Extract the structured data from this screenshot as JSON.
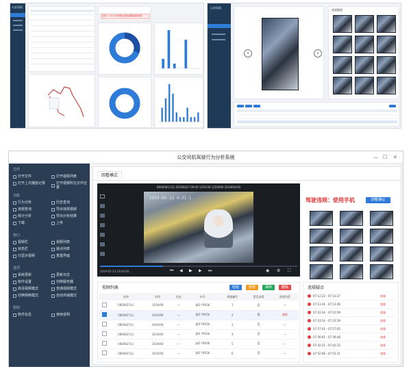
{
  "top_left": {
    "logo_text": "公交司机",
    "sidebar_items": [
      "",
      "",
      "",
      ""
    ],
    "alert_text": "注意：17:13:23司机在驾驶过程中使用手机",
    "timeline_title": "驾驶行为",
    "table_rows": [
      [
        "",
        "",
        "",
        "",
        "",
        ""
      ],
      [
        "",
        "",
        "",
        "",
        "",
        ""
      ]
    ],
    "bar_values_top": [
      2,
      8,
      1,
      0,
      6,
      0,
      0
    ],
    "bar_values_bottom": [
      3,
      5,
      8,
      6,
      2,
      1,
      1,
      3,
      1,
      1,
      2
    ],
    "donut_top": [
      0.55,
      0.45
    ],
    "donut_bottom": [
      0.9,
      0.1
    ]
  },
  "top_right": {
    "logo_text": "公交司机",
    "prev_icon": "chevron-left-icon",
    "next_icon": "chevron-right-icon",
    "thumb_title": "违规截图",
    "table_buttons": [
      "",
      "",
      "",
      ""
    ],
    "thumb_count": 12
  },
  "main": {
    "window_title": "公交司机驾驶行为分析系统",
    "window_controls": [
      "—",
      "□",
      "✕"
    ],
    "tab_label": "回看模式",
    "video_header": "D0000817(2) 20190427 09:09 1250:00 1250000 2019042(9)",
    "video_timestamp": "2019-05-12 4:31:1",
    "video_time_left": "2019-05-12 19:04:00",
    "violation_text": "驾驶违规：使用手机",
    "violation_button": "详细/静止",
    "video_list_title": "视频列表",
    "video_list_buttons": [
      "检验",
      "修改",
      "保存",
      "删除"
    ],
    "video_list_headers": [
      "名称",
      "时间",
      "状态",
      "车号",
      "线路编号",
      "是否违规",
      "违规内容"
    ],
    "video_list_rows": [
      {
        "checked": false,
        "name": "0800827(L)",
        "date": "2019/04",
        "status": "—",
        "car": "浙D Y903b",
        "line": "1",
        "violation": "否",
        "content": "—"
      },
      {
        "checked": true,
        "name": "0800827(L)",
        "date": "2019/04",
        "status": "—",
        "car": "浙D Y903b",
        "line": "2",
        "violation": "是",
        "content": "使用"
      },
      {
        "checked": false,
        "name": "0800827(L)",
        "date": "2019/04",
        "status": "—",
        "car": "浙D Y903b",
        "line": "3",
        "violation": "否",
        "content": "—"
      },
      {
        "checked": false,
        "name": "0800827(L)",
        "date": "2019/04",
        "status": "—",
        "car": "浙D Y903b",
        "line": "4",
        "violation": "否",
        "content": "—"
      },
      {
        "checked": false,
        "name": "0800827(L)",
        "date": "2019/04",
        "status": "—",
        "car": "浙D Y903b",
        "line": "5",
        "violation": "否",
        "content": "—"
      },
      {
        "checked": false,
        "name": "0800827(L)",
        "date": "2019/04",
        "status": "—",
        "car": "浙D Y903b",
        "line": "6",
        "violation": "否",
        "content": "—"
      }
    ],
    "violation_points_title": "违规疑点",
    "violation_points": [
      {
        "time": "07:12:22 - 07:13:27",
        "label": "违规"
      },
      {
        "time": "07:13:41 - 07:13:46",
        "label": "违规"
      },
      {
        "time": "07:22:34 - 07:22:59",
        "label": "违规"
      },
      {
        "time": "07:23:14 - 07:23:19",
        "label": "违规"
      },
      {
        "time": "07:27:01 - 07:27:05",
        "label": "违规"
      },
      {
        "time": "07:39:01 - 07:39:48",
        "label": "违规"
      },
      {
        "time": "07:42:21 - 07:42:25",
        "label": "违规"
      },
      {
        "time": "07:52:06 - 07:52:11",
        "label": "违规"
      }
    ],
    "sidebar": {
      "sections": [
        {
          "title": "文件",
          "items": [
            "打开文件",
            "打开视频列表",
            "打开上次播放记录",
            "打开视频所在文件位置"
          ]
        },
        {
          "title": "功能",
          "items": [
            "行为分析",
            "历史查询",
            "违规查询",
            "导出违规视频",
            "统计分析",
            "导出分析结果",
            "下载",
            "上传"
          ]
        },
        {
          "title": "窗口",
          "items": [
            "视频栏",
            "视频列表",
            "状态栏",
            "疑点列表",
            "只显示视频",
            "重置界面"
          ]
        },
        {
          "title": "选项",
          "items": [
            "系统更新",
            "更新日志",
            "软件设置",
            "切换服务器",
            "高清视频模式",
            "普通视频模式",
            "切换网络模式",
            "自动传输模式"
          ]
        },
        {
          "title": "帮助",
          "items": [
            "软件信息",
            "使用说明"
          ]
        }
      ]
    }
  }
}
